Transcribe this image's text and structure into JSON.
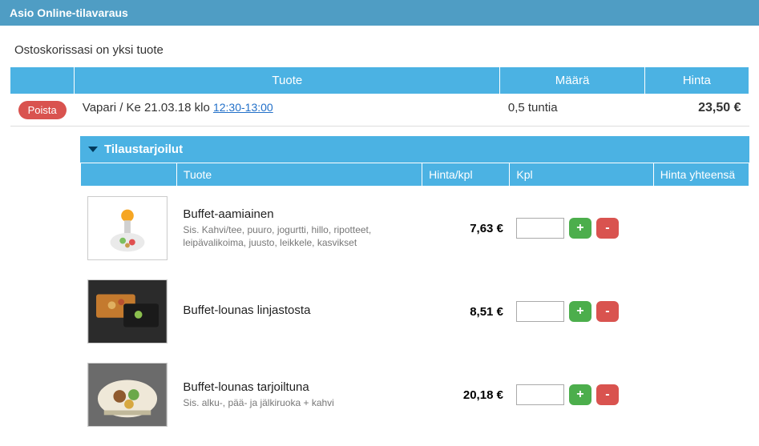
{
  "header": {
    "title": "Asio Online-tilavaraus"
  },
  "cart": {
    "summary": "Ostoskorissasi on yksi tuote"
  },
  "columns": {
    "tuote": "Tuote",
    "maara": "Määrä",
    "hinta": "Hinta"
  },
  "buttons": {
    "remove": "Poista",
    "plus": "+",
    "minus": "-"
  },
  "booking": {
    "name": "Vapari / Ke 21.03.18 klo ",
    "time": "12:30-13:00",
    "duration": "0,5 tuntia",
    "price": "23,50 €"
  },
  "catering": {
    "header": "Tilaustarjoilut",
    "columns": {
      "tuote": "Tuote",
      "hinta_kpl": "Hinta/kpl",
      "kpl": "Kpl",
      "hinta_yht": "Hinta yhteensä"
    },
    "items": [
      {
        "name": "Buffet-aamiainen",
        "desc": "Sis. Kahvi/tee, puuro, jogurtti, hillo, ripotteet, leipävalikoima, juusto, leikkele, kasvikset",
        "price": "7,63 €",
        "qty": ""
      },
      {
        "name": "Buffet-lounas linjastosta",
        "desc": "",
        "price": "8,51 €",
        "qty": ""
      },
      {
        "name": "Buffet-lounas tarjoiltuna",
        "desc": "Sis. alku-, pää- ja jälkiruoka + kahvi",
        "price": "20,18 €",
        "qty": ""
      }
    ]
  }
}
